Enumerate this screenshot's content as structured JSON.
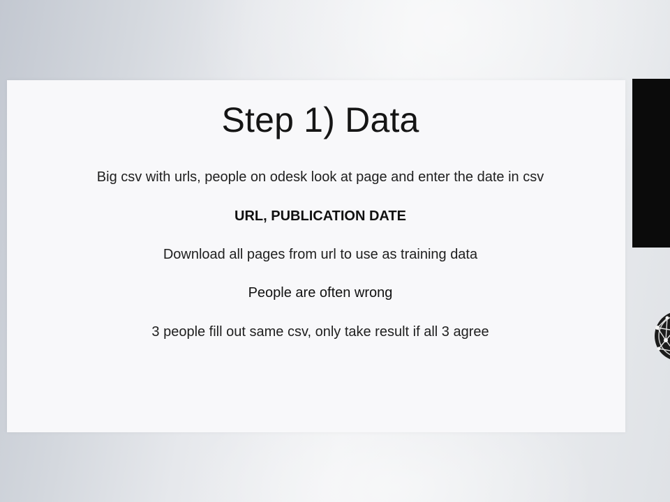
{
  "slide": {
    "title": "Step 1) Data",
    "lines": [
      "Big csv with urls, people on odesk look at page and enter the date in csv",
      "URL, PUBLICATION DATE",
      "Download all pages from url to use as training data",
      "People are often wrong",
      "3 people fill out same csv, only take result if all 3 agree"
    ]
  },
  "side_badge_icon": "network-globe-icon"
}
